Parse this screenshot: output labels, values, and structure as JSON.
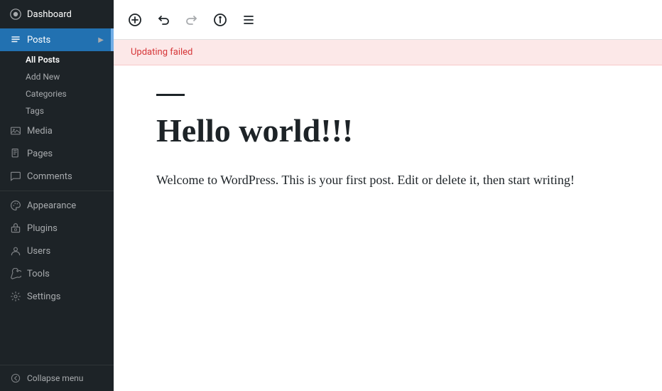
{
  "sidebar": {
    "logo": {
      "label": "Dashboard",
      "icon": "🏠"
    },
    "items": [
      {
        "id": "dashboard",
        "label": "Dashboard",
        "icon": "⊞",
        "active": false
      },
      {
        "id": "posts",
        "label": "Posts",
        "icon": "✎",
        "active": true
      },
      {
        "id": "media",
        "label": "Media",
        "icon": "🖼",
        "active": false
      },
      {
        "id": "pages",
        "label": "Pages",
        "icon": "📄",
        "active": false
      },
      {
        "id": "comments",
        "label": "Comments",
        "icon": "💬",
        "active": false
      },
      {
        "id": "appearance",
        "label": "Appearance",
        "icon": "🎨",
        "active": false
      },
      {
        "id": "plugins",
        "label": "Plugins",
        "icon": "🔌",
        "active": false
      },
      {
        "id": "users",
        "label": "Users",
        "icon": "👤",
        "active": false
      },
      {
        "id": "tools",
        "label": "Tools",
        "icon": "🔧",
        "active": false
      },
      {
        "id": "settings",
        "label": "Settings",
        "icon": "⚙",
        "active": false
      }
    ],
    "sub_items": [
      {
        "id": "all-posts",
        "label": "All Posts",
        "active": true
      },
      {
        "id": "add-new",
        "label": "Add New",
        "active": false
      },
      {
        "id": "categories",
        "label": "Categories",
        "active": false
      },
      {
        "id": "tags",
        "label": "Tags",
        "active": false
      }
    ],
    "collapse_label": "Collapse menu"
  },
  "toolbar": {
    "add_label": "+",
    "undo_label": "↩",
    "redo_label": "↪",
    "info_label": "ⓘ",
    "list_label": "≡"
  },
  "error_banner": {
    "message": "Updating failed"
  },
  "editor": {
    "title": "Hello world!!!",
    "body": "Welcome to WordPress. This is your first post. Edit or delete it, then start writing!"
  }
}
